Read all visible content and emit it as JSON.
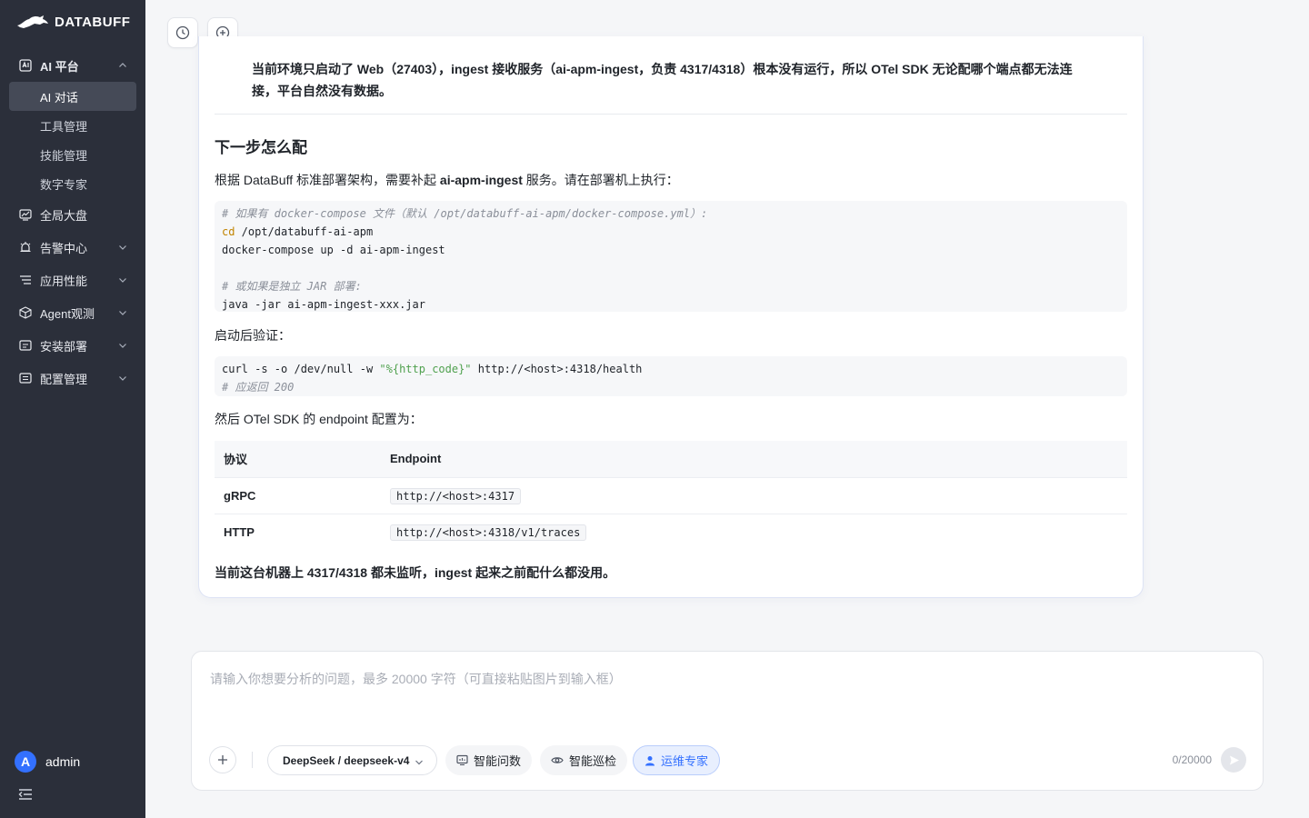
{
  "app": {
    "logo_text": "DATABUFF"
  },
  "sidebar": {
    "groups": [
      {
        "label": "AI 平台",
        "icon": "ai-platform-icon",
        "expanded": true,
        "items": [
          {
            "label": "AI 对话",
            "active": true
          },
          {
            "label": "工具管理"
          },
          {
            "label": "技能管理"
          },
          {
            "label": "数字专家"
          }
        ]
      },
      {
        "label": "全局大盘",
        "icon": "dashboard-icon"
      },
      {
        "label": "告警中心",
        "icon": "alarm-icon"
      },
      {
        "label": "应用性能",
        "icon": "apm-icon"
      },
      {
        "label": "Agent观测",
        "icon": "cube-icon"
      },
      {
        "label": "安装部署",
        "icon": "install-icon"
      },
      {
        "label": "配置管理",
        "icon": "config-icon"
      }
    ],
    "user": {
      "avatar_letter": "A",
      "name": "admin"
    }
  },
  "toolbar": {
    "history_icon": "clock-icon",
    "new_chat_icon": "plus-circle-icon"
  },
  "message": {
    "lead_text": "当前环境只启动了 Web（27403），ingest 接收服务（ai-apm-ingest，负责 4317/4318）根本没有运行，所以 OTel SDK 无论配哪个端点都无法连接，平台自然没有数据。",
    "heading": "下一步怎么配",
    "intro_prefix": "根据 DataBuff 标准部署架构，需要补起 ",
    "intro_bold": "ai-apm-ingest",
    "intro_suffix": " 服务。请在部署机上执行：",
    "code1": {
      "comment1": "# 如果有 docker-compose 文件（默认 /opt/databuff-ai-apm/docker-compose.yml）:",
      "cd_keyword": "cd",
      "cd_path": " /opt/databuff-ai-apm",
      "line3": "docker-compose up -d ai-apm-ingest",
      "comment2": "# 或如果是独立 JAR 部署:",
      "line5": "java -jar ai-apm-ingest-xxx.jar"
    },
    "verify_label": "启动后验证：",
    "code2": {
      "cmd_prefix": "curl -s -o /dev/null -w ",
      "cmd_string": "\"%{http_code}\"",
      "cmd_suffix": " http://<host>:4318/health",
      "comment": "# 应返回 200"
    },
    "endpoint_intro": "然后 OTel SDK 的 endpoint 配置为：",
    "table": {
      "headers": [
        "协议",
        "Endpoint"
      ],
      "rows": [
        [
          "gRPC",
          "http://<host>:4317"
        ],
        [
          "HTTP",
          "http://<host>:4318/v1/traces"
        ]
      ]
    },
    "final_note": "当前这台机器上 4317/4318 都未监听，ingest 起来之前配什么都没用。"
  },
  "input": {
    "placeholder": "请输入你想要分析的问题，最多 20000 字符（可直接粘贴图片到输入框）",
    "value": "",
    "model": "DeepSeek / deepseek-v4",
    "chips": [
      {
        "label": "智能问数",
        "icon": "chart-icon",
        "active": false
      },
      {
        "label": "智能巡检",
        "icon": "eye-icon",
        "active": false
      },
      {
        "label": "运维专家",
        "icon": "user-icon",
        "active": true
      }
    ],
    "counter": "0/20000"
  },
  "colors": {
    "sidebar_bg": "#2b2f3a",
    "accent": "#3370ff",
    "active_item_bg": "#454a57"
  }
}
